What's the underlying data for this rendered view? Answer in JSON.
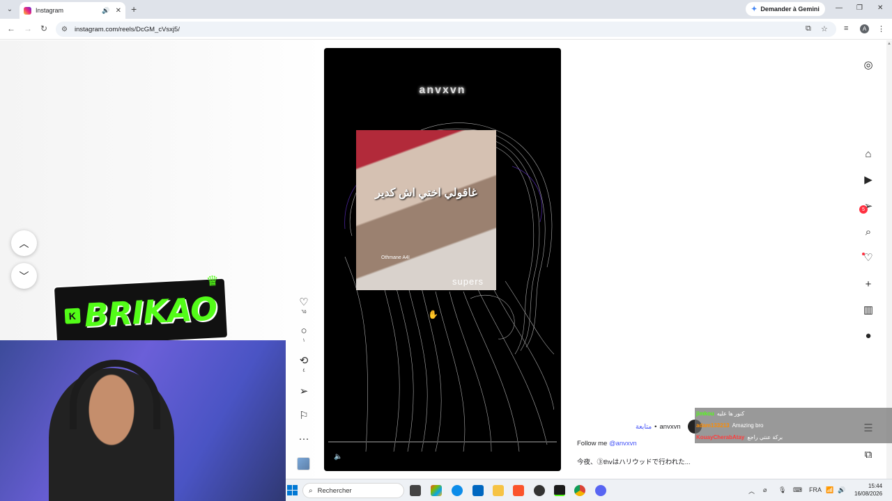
{
  "browser": {
    "tab_title": "Instagram",
    "url": "instagram.com/reels/DcGM_cVsxj5/",
    "gemini_label": "Demander à Gemini",
    "profile_initial": "A"
  },
  "reel": {
    "watermark": "anvxvn",
    "arabic_text": "غاقولي اختي اش كدير",
    "inset_signature": "Othmane A4I",
    "overlay_text": "supers"
  },
  "actions": {
    "likes": "٦٥",
    "comments": "١",
    "reposts": "٤"
  },
  "overlay": {
    "brand": "BRIKAO",
    "brand_letter": "K"
  },
  "sidebar": {
    "messages_badge": "5"
  },
  "caption": {
    "follow_label": "متابعة",
    "username": "anvxvn",
    "line1_prefix": "Follow me",
    "line1_mention": "@anvxvn",
    "line2": "今夜、③thvはハリウッドで行われた..."
  },
  "chat": [
    {
      "user": "jimkou",
      "message": "كنور ها عليه",
      "color": "#53fc18"
    },
    {
      "user": "adam133213",
      "message": "Amazing bro",
      "color": "#ff8c00"
    },
    {
      "user": "KouayCherabAtay",
      "message": "بركة عنتي راجع",
      "color": "#ff3b3b"
    }
  ],
  "taskbar": {
    "search_placeholder": "Rechercher",
    "language": "FRA",
    "time": "15:44",
    "date": "16/08/2026"
  }
}
